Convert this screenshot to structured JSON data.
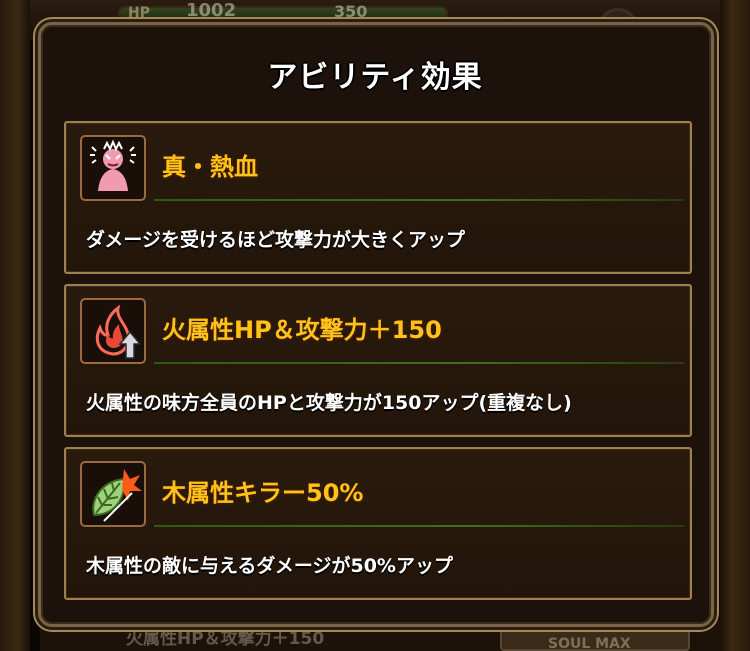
{
  "background": {
    "hp_label": "HP",
    "hp_value": "1002",
    "atk_value": "350",
    "bottom_text": "火属性HP＆攻撃力＋150",
    "soul_button": "SOUL MAX"
  },
  "dialog": {
    "title": "アビリティ効果",
    "abilities": [
      {
        "icon": "rage-spirit-icon",
        "name": "真・熱血",
        "description": "ダメージを受けるほど攻撃力が大きくアップ"
      },
      {
        "icon": "fire-up-arrow-icon",
        "name": "火属性HP＆攻撃力＋150",
        "description": "火属性の味方全員のHPと攻撃力が150アップ(重複なし)"
      },
      {
        "icon": "leaf-slash-icon",
        "name": "木属性キラー50%",
        "description": "木属性の敵に与えるダメージが50%アップ"
      }
    ]
  },
  "colors": {
    "ability_name": "#ffc21a",
    "card_border": "#a08050",
    "divider": "#3f6f1c"
  }
}
